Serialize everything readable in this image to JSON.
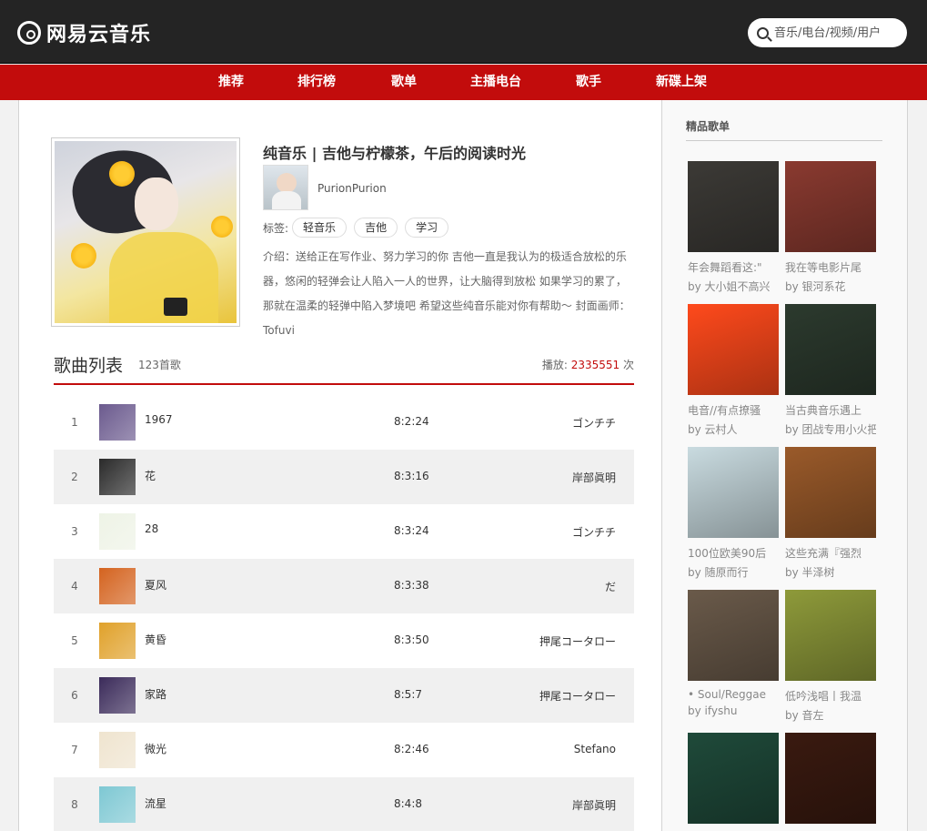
{
  "header": {
    "logo_text": "网易云音乐",
    "search_placeholder": "音乐/电台/视频/用户"
  },
  "nav": [
    "推荐",
    "排行榜",
    "歌单",
    "主播电台",
    "歌手",
    "新碟上架"
  ],
  "playlist": {
    "title": "纯音乐 | 吉他与柠檬茶，午后的阅读时光",
    "creator": "PurionPurion",
    "tags_label": "标签:",
    "tags": [
      "轻音乐",
      "吉他",
      "学习"
    ],
    "description": "介绍：送给正在写作业、努力学习的你 吉他一直是我认为的极适合放松的乐器，悠闲的轻弹会让人陷入一人的世界，让大脑得到放松 如果学习的累了，那就在温柔的轻弹中陷入梦境吧 希望这些纯音乐能对你有帮助～ 封面画师：Tofuvi"
  },
  "song_list": {
    "title": "歌曲列表",
    "count": "123首歌",
    "play_label": "播放:",
    "play_count": "2335551",
    "play_unit": "次",
    "songs": [
      {
        "index": "1",
        "name": "1967",
        "duration": "8:2:24",
        "artist": "ゴンチチ",
        "cover_color": "#6b5a8e"
      },
      {
        "index": "2",
        "name": "花",
        "duration": "8:3:16",
        "artist": "岸部眞明",
        "cover_color": "#2a2a2a"
      },
      {
        "index": "3",
        "name": "28",
        "duration": "8:3:24",
        "artist": "ゴンチチ",
        "cover_color": "#eef3e6"
      },
      {
        "index": "4",
        "name": "夏风",
        "duration": "8:3:38",
        "artist": "だ",
        "cover_color": "#d4631f"
      },
      {
        "index": "5",
        "name": "黄昏",
        "duration": "8:3:50",
        "artist": "押尾コータロー",
        "cover_color": "#e0a12a"
      },
      {
        "index": "6",
        "name": "家路",
        "duration": "8:5:7",
        "artist": "押尾コータロー",
        "cover_color": "#3b2b5a"
      },
      {
        "index": "7",
        "name": "微光",
        "duration": "8:2:46",
        "artist": "Stefano",
        "cover_color": "#efe4cf"
      },
      {
        "index": "8",
        "name": "流星",
        "duration": "8:4:8",
        "artist": "岸部眞明",
        "cover_color": "#7ec8d3"
      }
    ]
  },
  "sidebar": {
    "title": "精品歌单",
    "cards": [
      {
        "name": "年会舞蹈看这:\"",
        "by": "by 大小姐不高兴",
        "color": "#3c3a36"
      },
      {
        "name": "我在等电影片尾",
        "by": "by 银河系花",
        "color": "#8a3a30"
      },
      {
        "name": "电音//有点撩骚",
        "by": "by 云村人",
        "color": "#ff4a1c"
      },
      {
        "name": "当古典音乐遇上",
        "by": "by 团战专用小火把",
        "color": "#2c3a2e"
      },
      {
        "name": "100位欧美90后",
        "by": "by 随原而行",
        "color": "#c9dbe0"
      },
      {
        "name": "这些充满『强烈",
        "by": "by 半泽树",
        "color": "#9a5a2a"
      },
      {
        "name": "• Soul/Reggae",
        "by": "by ifyshu",
        "color": "#6a5a4a"
      },
      {
        "name": "低吟浅唱丨我温",
        "by": "by 音左",
        "color": "#8e9a3a"
      },
      {
        "name": "",
        "by": "",
        "color": "#1f4a3a"
      },
      {
        "name": "",
        "by": "",
        "color": "#3a1a10"
      }
    ]
  }
}
